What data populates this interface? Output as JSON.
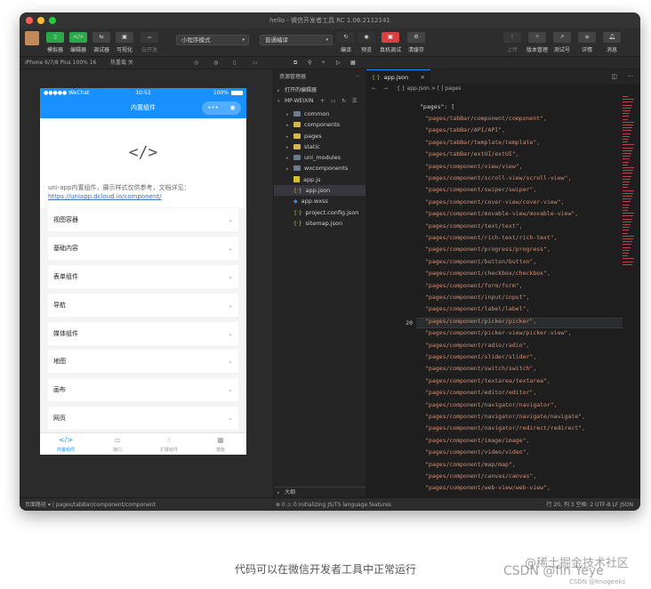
{
  "window": {
    "title": "hello - 微信开发者工具 RC 1.06.2112141"
  },
  "toolbar": {
    "left_buttons": [
      {
        "icon": "phone-icon",
        "label": "模拟器"
      },
      {
        "icon": "code-icon",
        "label": "编辑器"
      },
      {
        "icon": "debug-icon",
        "label": "调试器"
      },
      {
        "icon": "visual-icon",
        "label": "可视化"
      },
      {
        "icon": "cloud-icon",
        "label": "云开发"
      }
    ],
    "mode_select": "小程序模式",
    "compile_select": "普通编译",
    "mid_buttons": [
      {
        "icon": "refresh-icon",
        "label": "编译"
      },
      {
        "icon": "eye-icon",
        "label": "预览"
      },
      {
        "icon": "qrcode-icon",
        "label": "真机调试"
      },
      {
        "icon": "gear-icon",
        "label": "清缓存"
      }
    ],
    "right_buttons": [
      {
        "icon": "upload-icon",
        "label": "上传"
      },
      {
        "icon": "branch-icon",
        "label": "版本管理"
      },
      {
        "icon": "share-icon",
        "label": "测试号"
      },
      {
        "icon": "menu-icon",
        "label": "详情"
      },
      {
        "icon": "bell-icon",
        "label": "消息"
      }
    ]
  },
  "subbar": {
    "device": "iPhone 6/7/8 Plus 100% 16",
    "network": "热重载 关"
  },
  "phone": {
    "status": {
      "carrier": "●●●●● WeChat",
      "time": "10:52",
      "battery": "100%"
    },
    "nav_title": "内置组件",
    "capsule": {
      "more": "•••",
      "close": "◉"
    },
    "code_glyph": "</>",
    "intro_text": "uni-app内置组件，展示样式仅供参考，文档详见：",
    "intro_link": "https://uniapp.dcloud.io/component/",
    "list": [
      {
        "label": "视图容器"
      },
      {
        "label": "基础内容"
      },
      {
        "label": "表单组件"
      },
      {
        "label": "导航"
      },
      {
        "label": "媒体组件"
      },
      {
        "label": "地图"
      },
      {
        "label": "画布"
      },
      {
        "label": "网页"
      }
    ],
    "chevron": "⌄",
    "tabbar": [
      {
        "glyph": "</>",
        "label": "内置组件",
        "active": true
      },
      {
        "glyph": "▭",
        "label": "接口",
        "active": false
      },
      {
        "glyph": "☝",
        "label": "扩展组件",
        "active": false
      },
      {
        "glyph": "▦",
        "label": "模板",
        "active": false
      }
    ]
  },
  "explorer": {
    "header": "资源管理器",
    "opened_editors": "打开的编辑器",
    "project": "MP-WEIXIN",
    "items": [
      {
        "name": "common",
        "kind": "folder"
      },
      {
        "name": "components",
        "kind": "folder-yellow"
      },
      {
        "name": "pages",
        "kind": "folder-yellow"
      },
      {
        "name": "static",
        "kind": "folder-yellow"
      },
      {
        "name": "uni_modules",
        "kind": "folder"
      },
      {
        "name": "wxcomponents",
        "kind": "folder"
      },
      {
        "name": "app.js",
        "kind": "js"
      },
      {
        "name": "app.json",
        "kind": "json"
      },
      {
        "name": "app.wxss",
        "kind": "wxss"
      },
      {
        "name": "project.config.json",
        "kind": "json"
      },
      {
        "name": "sitemap.json",
        "kind": "json"
      }
    ],
    "outline": "大纲"
  },
  "editor": {
    "tab": "app.json",
    "breadcrumb": "{ } app.json > [ ] pages",
    "current_line_number": "20",
    "key_line": "\"pages\": [",
    "lines": [
      "\"pages/tabBar/component/component\",",
      "\"pages/tabBar/API/API\",",
      "\"pages/tabBar/template/template\",",
      "\"pages/tabBar/extUI/extUI\",",
      "\"pages/component/view/view\",",
      "\"pages/component/scroll-view/scroll-view\",",
      "\"pages/component/swiper/swiper\",",
      "\"pages/component/cover-view/cover-view\",",
      "\"pages/component/movable-view/movable-view\",",
      "\"pages/component/text/text\",",
      "\"pages/component/rich-text/rich-text\",",
      "\"pages/component/progress/progress\",",
      "\"pages/component/button/button\",",
      "\"pages/component/checkbox/checkbox\",",
      "\"pages/component/form/form\",",
      "\"pages/component/input/input\",",
      "\"pages/component/label/label\",",
      "\"pages/component/picker/picker\",",
      "\"pages/component/picker-view/picker-view\",",
      "\"pages/component/radio/radio\",",
      "\"pages/component/slider/slider\",",
      "\"pages/component/switch/switch\",",
      "\"pages/component/textarea/textarea\",",
      "\"pages/component/editor/editor\",",
      "\"pages/component/navigator/navigator\",",
      "\"pages/component/navigator/navigate/navigate\",",
      "\"pages/component/navigator/redirect/redirect\",",
      "\"pages/component/image/image\",",
      "\"pages/component/video/video\",",
      "\"pages/component/map/map\",",
      "\"pages/component/canvas/canvas\",",
      "\"pages/component/web-view/web-view\","
    ]
  },
  "statusbar": {
    "left": "页面路径 ▾   |   pages/tabBar/component/component",
    "problems": "⊗ 0 ⚠ 0   Initializing JS/TS language features",
    "right": "行 20, 列 3    空格: 2    UTF-8    LF    JSON"
  },
  "caption": "代码可以在微信开发者工具中正常运行",
  "watermarks": {
    "a": "@稀土掘金技术社区",
    "b": "CSDN @fin Yeye",
    "c": "CSDN @hnogeeks"
  }
}
